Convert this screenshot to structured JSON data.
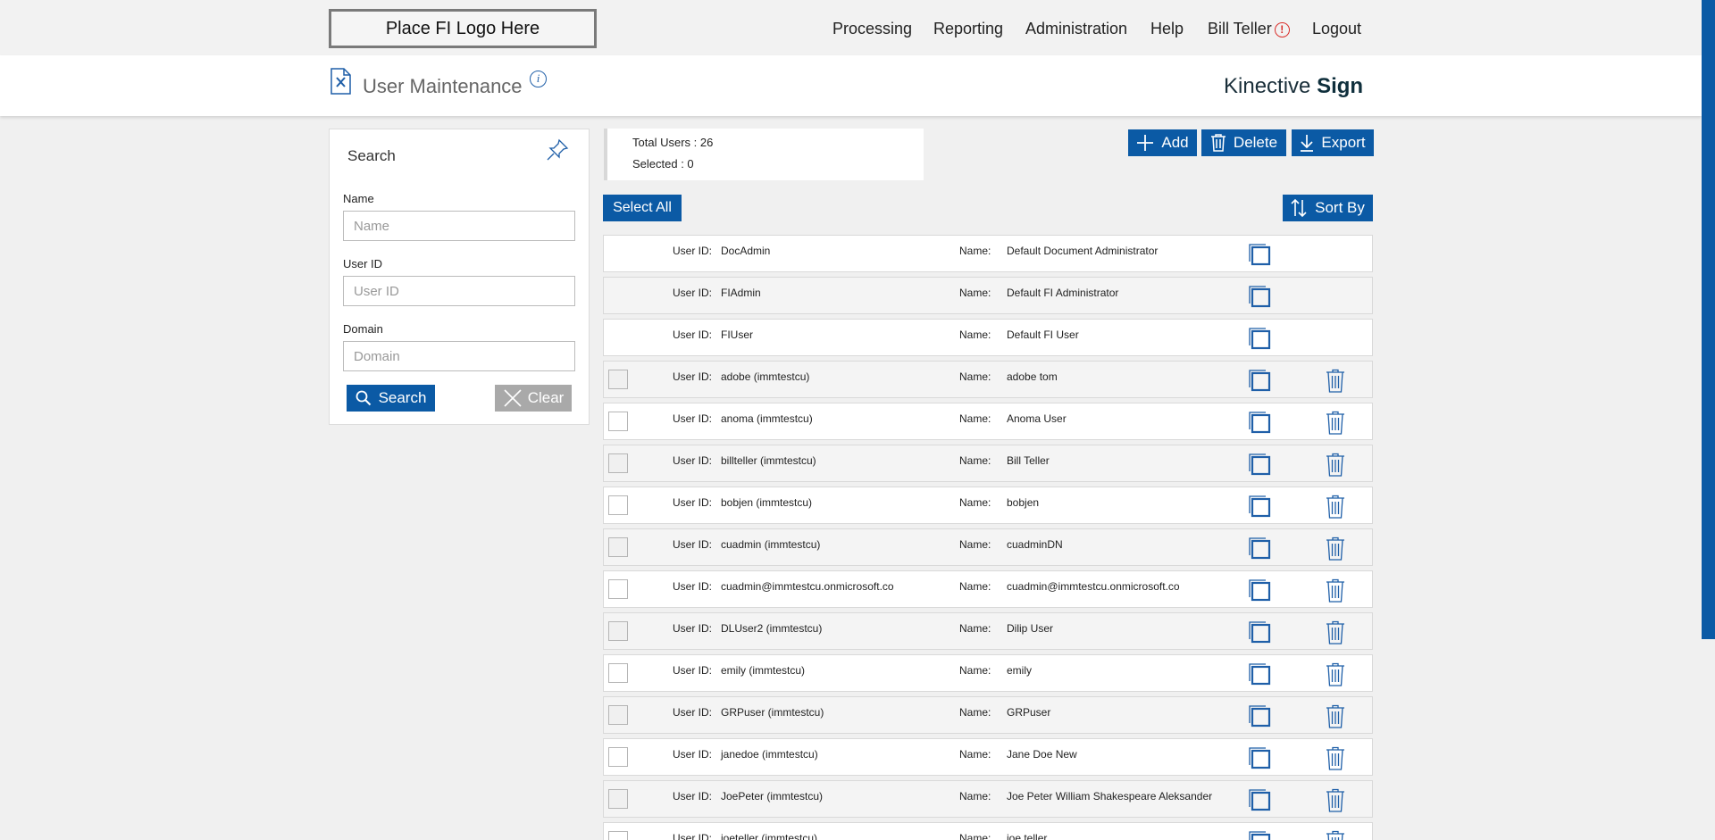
{
  "logo": {
    "text": "Place FI Logo Here"
  },
  "nav": {
    "processing": "Processing",
    "reporting": "Reporting",
    "administration": "Administration",
    "help": "Help",
    "user": "Bill Teller",
    "logout": "Logout"
  },
  "header": {
    "title": "User Maintenance",
    "brand_light": "Kinective ",
    "brand_bold": "Sign"
  },
  "search": {
    "title": "Search",
    "name_label": "Name",
    "name_placeholder": "Name",
    "userid_label": "User ID",
    "userid_placeholder": "User ID",
    "domain_label": "Domain",
    "domain_placeholder": "Domain",
    "search_button": "Search",
    "clear_button": "Clear"
  },
  "totals": {
    "total_users": "Total Users : 26",
    "selected": "Selected : 0"
  },
  "actions": {
    "add": "Add",
    "delete": "Delete",
    "export": "Export",
    "select_all": "Select All",
    "sort_by": "Sort By"
  },
  "row_labels": {
    "user_id": "User ID:",
    "name": "Name:"
  },
  "users": [
    {
      "user_id": "DocAdmin",
      "name": "Default Document Administrator",
      "system": true
    },
    {
      "user_id": "FIAdmin",
      "name": "Default FI Administrator",
      "system": true
    },
    {
      "user_id": "FIUser",
      "name": "Default FI User",
      "system": true
    },
    {
      "user_id": "adobe (immtestcu)",
      "name": "adobe tom",
      "system": false
    },
    {
      "user_id": "anoma (immtestcu)",
      "name": "Anoma User",
      "system": false
    },
    {
      "user_id": "billteller (immtestcu)",
      "name": "Bill Teller",
      "system": false
    },
    {
      "user_id": "bobjen (immtestcu)",
      "name": "bobjen",
      "system": false
    },
    {
      "user_id": "cuadmin (immtestcu)",
      "name": "cuadminDN",
      "system": false
    },
    {
      "user_id": "cuadmin@immtestcu.onmicrosoft.co",
      "name": "cuadmin@immtestcu.onmicrosoft.co",
      "system": false
    },
    {
      "user_id": "DLUser2 (immtestcu)",
      "name": "Dilip User",
      "system": false
    },
    {
      "user_id": "emily (immtestcu)",
      "name": "emily",
      "system": false
    },
    {
      "user_id": "GRPuser (immtestcu)",
      "name": "GRPuser",
      "system": false
    },
    {
      "user_id": "janedoe (immtestcu)",
      "name": "Jane Doe New",
      "system": false
    },
    {
      "user_id": "JoePeter (immtestcu)",
      "name": "Joe Peter William Shakespeare Aleksander",
      "system": false
    },
    {
      "user_id": "joeteller (immtestcu)",
      "name": "joe teller",
      "system": false
    }
  ],
  "colors": {
    "primary": "#0b5aa5",
    "alert": "#d9302c",
    "clear_button": "#a9a9a9"
  },
  "icons": [
    "document-edit-icon",
    "info-icon",
    "pin-icon",
    "search-icon",
    "close-icon",
    "plus-icon",
    "trash-icon",
    "download-icon",
    "sort-icon",
    "copy-icon",
    "alert-icon"
  ]
}
